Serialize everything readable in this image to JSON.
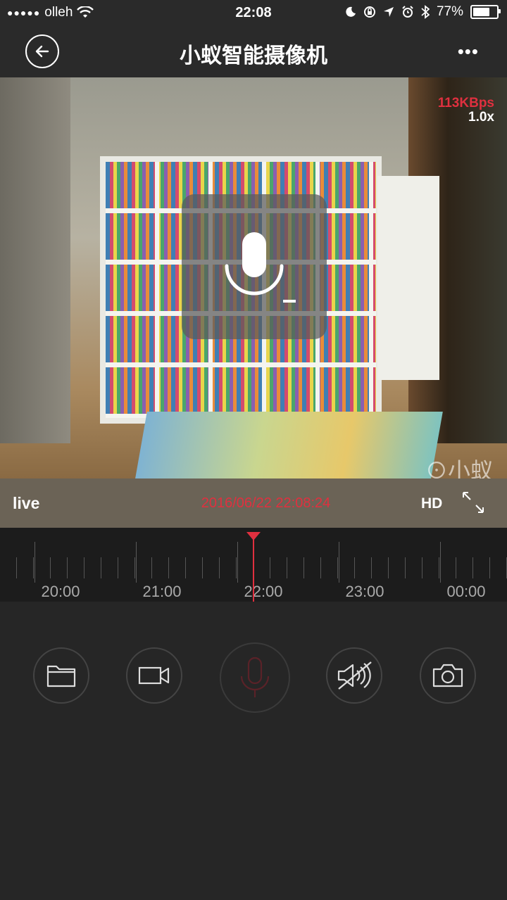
{
  "status_bar": {
    "signal_dots": "●●●●●",
    "carrier": "olleh",
    "time": "22:08",
    "battery_percent": "77%",
    "battery_level": 0.77
  },
  "nav": {
    "title": "小蚁智能摄像机",
    "more_label": "•••"
  },
  "video": {
    "bitrate": "113KBps",
    "zoom": "1.0x",
    "watermark": "小蚁"
  },
  "video_bar": {
    "live_label": "live",
    "timestamp": "2016/06/22 22:08:24",
    "quality_label": "HD"
  },
  "timeline": {
    "labels": [
      "20:00",
      "21:00",
      "22:00",
      "23:00",
      "00:00"
    ]
  },
  "controls": {
    "buttons": [
      "folder-icon",
      "video-record-icon",
      "microphone-icon",
      "speaker-muted-icon",
      "camera-icon"
    ]
  },
  "colors": {
    "accent": "#e0303f",
    "background": "#262626",
    "nav_background": "#2a2a2a"
  }
}
